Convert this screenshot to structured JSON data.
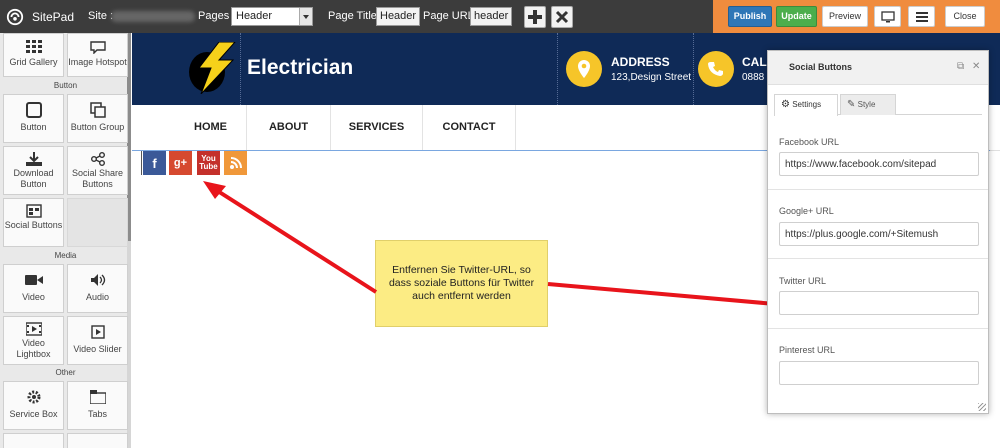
{
  "topbar": {
    "brand": "SitePad",
    "site_label": "Site :",
    "pages_label": "Pages :",
    "pages_value": "Header",
    "page_title_label": "Page Title:",
    "page_title_value": "Header",
    "page_url_label": "Page URL:",
    "page_url_value": "header",
    "publish": "Publish",
    "update": "Update",
    "preview": "Preview",
    "close": "Close"
  },
  "sidebar": {
    "tiles": [
      {
        "label": "Grid Gallery",
        "icon": "grid-icon"
      },
      {
        "label": "Image Hotspot",
        "icon": "chat-bubble-icon"
      },
      {
        "label": "Button",
        "icon": "square-icon"
      },
      {
        "label": "Button Group",
        "icon": "copy-icon"
      },
      {
        "label": "Download Button",
        "icon": "download-icon"
      },
      {
        "label": "Social Share Buttons",
        "icon": "share-icon"
      },
      {
        "label": "Social Buttons",
        "icon": "social-buttons-icon"
      },
      {
        "label": "Video",
        "icon": "video-camera-icon"
      },
      {
        "label": "Audio",
        "icon": "speaker-icon"
      },
      {
        "label": "Video Lightbox",
        "icon": "film-icon"
      },
      {
        "label": "Video Slider",
        "icon": "play-square-icon"
      },
      {
        "label": "Service Box",
        "icon": "gear-icon"
      },
      {
        "label": "Tabs",
        "icon": "tabs-icon"
      }
    ],
    "sections": [
      "Button",
      "Media",
      "Other"
    ]
  },
  "site": {
    "name": "Electrician",
    "address_title": "ADDRESS",
    "address_value": "123,Design Street",
    "call_title": "CAL",
    "call_value": "0888",
    "nav": [
      "HOME",
      "ABOUT",
      "SERVICES",
      "CONTACT"
    ],
    "social_glyphs": {
      "facebook": "f",
      "googleplus": "g+",
      "youtube": "You Tube"
    }
  },
  "callout": {
    "text": "Entfernen Sie Twitter-URL, so dass soziale Buttons für Twitter auch entfernt werden"
  },
  "panel": {
    "title": "Social Buttons",
    "tabs": [
      "Settings",
      "Style"
    ],
    "fields": [
      {
        "label": "Facebook URL",
        "value": "https://www.facebook.com/sitepad"
      },
      {
        "label": "Google+ URL",
        "value": "https://plus.google.com/+Sitemush"
      },
      {
        "label": "Twitter URL",
        "value": ""
      },
      {
        "label": "Pinterest URL",
        "value": ""
      }
    ]
  },
  "colors": {
    "topbar": "#3c3c3c",
    "topbar_right": "#f08c3e",
    "site_header": "#0f2a57",
    "accent_yellow": "#f6c529",
    "arrow": "#e8141b"
  }
}
